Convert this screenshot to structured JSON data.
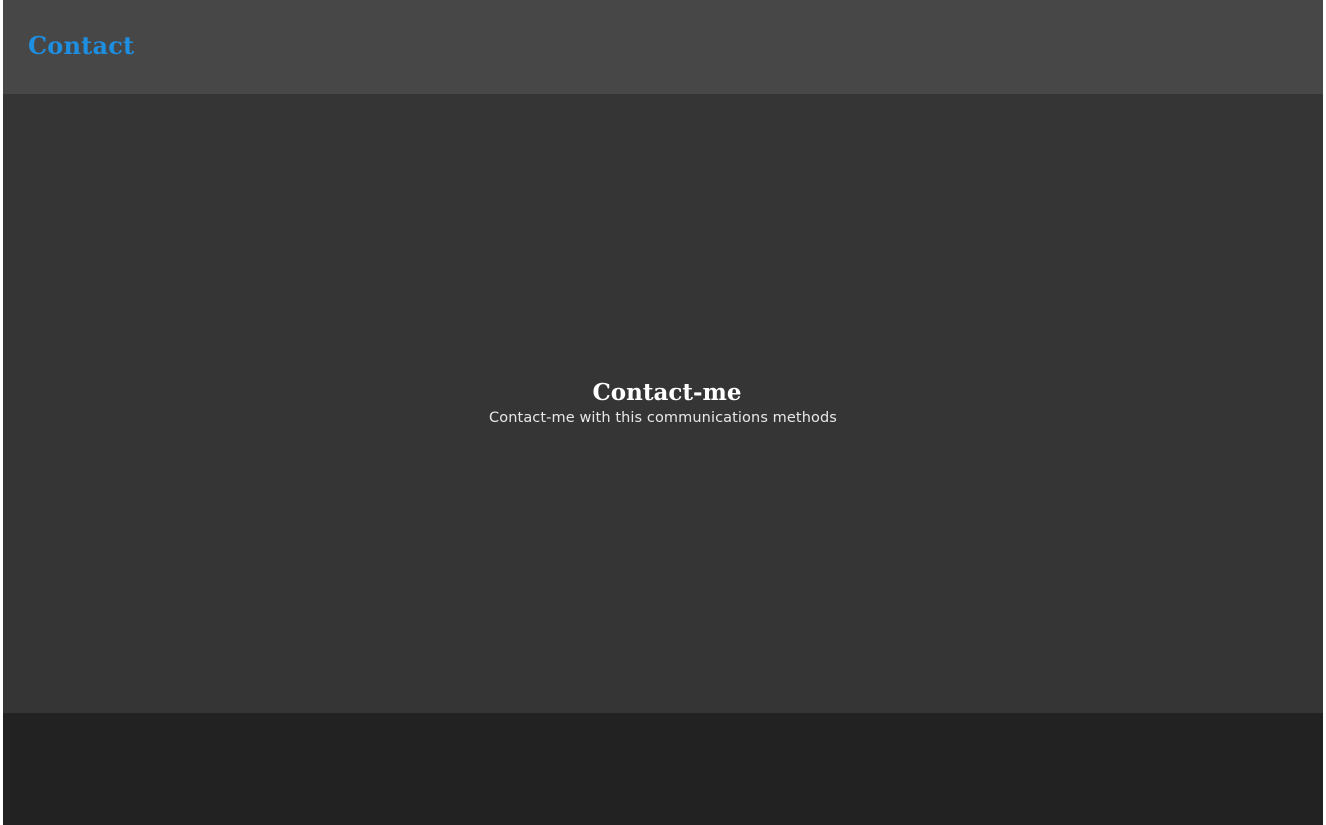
{
  "header": {
    "title": "Contact"
  },
  "main": {
    "title": "Contact-me",
    "subtitle": "Contact-me with this communications methods"
  },
  "colors": {
    "header_bg": "#474747",
    "header_title": "#1e8ee0",
    "main_bg": "#353535",
    "footer_bg": "#222222",
    "text": "#ffffff"
  }
}
